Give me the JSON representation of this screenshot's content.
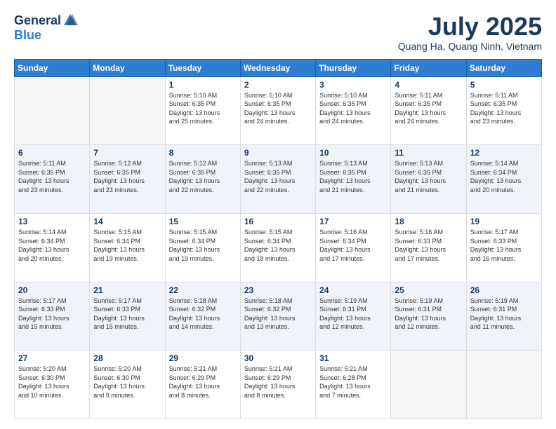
{
  "header": {
    "logo": {
      "general": "General",
      "blue": "Blue"
    },
    "title": "July 2025",
    "location": "Quang Ha, Quang Ninh, Vietnam"
  },
  "weekdays": [
    "Sunday",
    "Monday",
    "Tuesday",
    "Wednesday",
    "Thursday",
    "Friday",
    "Saturday"
  ],
  "weeks": [
    [
      {
        "day": "",
        "info": ""
      },
      {
        "day": "",
        "info": ""
      },
      {
        "day": "1",
        "info": "Sunrise: 5:10 AM\nSunset: 6:35 PM\nDaylight: 13 hours\nand 25 minutes."
      },
      {
        "day": "2",
        "info": "Sunrise: 5:10 AM\nSunset: 6:35 PM\nDaylight: 13 hours\nand 24 minutes."
      },
      {
        "day": "3",
        "info": "Sunrise: 5:10 AM\nSunset: 6:35 PM\nDaylight: 13 hours\nand 24 minutes."
      },
      {
        "day": "4",
        "info": "Sunrise: 5:11 AM\nSunset: 6:35 PM\nDaylight: 13 hours\nand 24 minutes."
      },
      {
        "day": "5",
        "info": "Sunrise: 5:11 AM\nSunset: 6:35 PM\nDaylight: 13 hours\nand 23 minutes."
      }
    ],
    [
      {
        "day": "6",
        "info": "Sunrise: 5:11 AM\nSunset: 6:35 PM\nDaylight: 13 hours\nand 23 minutes."
      },
      {
        "day": "7",
        "info": "Sunrise: 5:12 AM\nSunset: 6:35 PM\nDaylight: 13 hours\nand 23 minutes."
      },
      {
        "day": "8",
        "info": "Sunrise: 5:12 AM\nSunset: 6:35 PM\nDaylight: 13 hours\nand 22 minutes."
      },
      {
        "day": "9",
        "info": "Sunrise: 5:13 AM\nSunset: 6:35 PM\nDaylight: 13 hours\nand 22 minutes."
      },
      {
        "day": "10",
        "info": "Sunrise: 5:13 AM\nSunset: 6:35 PM\nDaylight: 13 hours\nand 21 minutes."
      },
      {
        "day": "11",
        "info": "Sunrise: 5:13 AM\nSunset: 6:35 PM\nDaylight: 13 hours\nand 21 minutes."
      },
      {
        "day": "12",
        "info": "Sunrise: 5:14 AM\nSunset: 6:34 PM\nDaylight: 13 hours\nand 20 minutes."
      }
    ],
    [
      {
        "day": "13",
        "info": "Sunrise: 5:14 AM\nSunset: 6:34 PM\nDaylight: 13 hours\nand 20 minutes."
      },
      {
        "day": "14",
        "info": "Sunrise: 5:15 AM\nSunset: 6:34 PM\nDaylight: 13 hours\nand 19 minutes."
      },
      {
        "day": "15",
        "info": "Sunrise: 5:15 AM\nSunset: 6:34 PM\nDaylight: 13 hours\nand 19 minutes."
      },
      {
        "day": "16",
        "info": "Sunrise: 5:15 AM\nSunset: 6:34 PM\nDaylight: 13 hours\nand 18 minutes."
      },
      {
        "day": "17",
        "info": "Sunrise: 5:16 AM\nSunset: 6:34 PM\nDaylight: 13 hours\nand 17 minutes."
      },
      {
        "day": "18",
        "info": "Sunrise: 5:16 AM\nSunset: 6:33 PM\nDaylight: 13 hours\nand 17 minutes."
      },
      {
        "day": "19",
        "info": "Sunrise: 5:17 AM\nSunset: 6:33 PM\nDaylight: 13 hours\nand 16 minutes."
      }
    ],
    [
      {
        "day": "20",
        "info": "Sunrise: 5:17 AM\nSunset: 6:33 PM\nDaylight: 13 hours\nand 15 minutes."
      },
      {
        "day": "21",
        "info": "Sunrise: 5:17 AM\nSunset: 6:33 PM\nDaylight: 13 hours\nand 15 minutes."
      },
      {
        "day": "22",
        "info": "Sunrise: 5:18 AM\nSunset: 6:32 PM\nDaylight: 13 hours\nand 14 minutes."
      },
      {
        "day": "23",
        "info": "Sunrise: 5:18 AM\nSunset: 6:32 PM\nDaylight: 13 hours\nand 13 minutes."
      },
      {
        "day": "24",
        "info": "Sunrise: 5:19 AM\nSunset: 6:31 PM\nDaylight: 13 hours\nand 12 minutes."
      },
      {
        "day": "25",
        "info": "Sunrise: 5:19 AM\nSunset: 6:31 PM\nDaylight: 13 hours\nand 12 minutes."
      },
      {
        "day": "26",
        "info": "Sunrise: 5:19 AM\nSunset: 6:31 PM\nDaylight: 13 hours\nand 11 minutes."
      }
    ],
    [
      {
        "day": "27",
        "info": "Sunrise: 5:20 AM\nSunset: 6:30 PM\nDaylight: 13 hours\nand 10 minutes."
      },
      {
        "day": "28",
        "info": "Sunrise: 5:20 AM\nSunset: 6:30 PM\nDaylight: 13 hours\nand 9 minutes."
      },
      {
        "day": "29",
        "info": "Sunrise: 5:21 AM\nSunset: 6:29 PM\nDaylight: 13 hours\nand 8 minutes."
      },
      {
        "day": "30",
        "info": "Sunrise: 5:21 AM\nSunset: 6:29 PM\nDaylight: 13 hours\nand 8 minutes."
      },
      {
        "day": "31",
        "info": "Sunrise: 5:21 AM\nSunset: 6:28 PM\nDaylight: 13 hours\nand 7 minutes."
      },
      {
        "day": "",
        "info": ""
      },
      {
        "day": "",
        "info": ""
      }
    ]
  ]
}
